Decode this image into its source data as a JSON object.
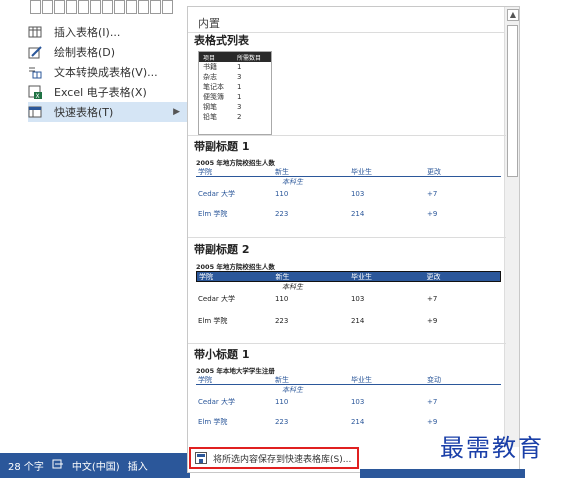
{
  "menu": {
    "items": [
      {
        "label": "插入表格(I)...",
        "icon": "table-grid-icon"
      },
      {
        "label": "绘制表格(D)",
        "icon": "pencil-table-icon"
      },
      {
        "label": "文本转换成表格(V)...",
        "icon": "text-to-table-icon"
      },
      {
        "label": "Excel 电子表格(X)",
        "icon": "excel-icon"
      },
      {
        "label": "快速表格(T)",
        "icon": "quick-table-icon",
        "active": true,
        "arrow": "▶"
      }
    ]
  },
  "status": {
    "word_count": "28 个字",
    "language": "中文(中国)",
    "mode": "插入"
  },
  "gallery": {
    "header": "内置",
    "sections": [
      {
        "title": "表格式列表"
      },
      {
        "title": "带副标题 1"
      },
      {
        "title": "带副标题 2"
      },
      {
        "title": "带小标题 1"
      }
    ],
    "tabular_list": {
      "headers": [
        "项目",
        "所需数目"
      ],
      "rows": [
        [
          "书籍",
          "1"
        ],
        [
          "杂志",
          "3"
        ],
        [
          "笔记本",
          "1"
        ],
        [
          "便笺簿",
          "1"
        ],
        [
          "钢笔",
          "3"
        ],
        [
          "铅笔",
          "2"
        ]
      ]
    },
    "subtitle1": {
      "caption": "2005 年地方院校招生人数",
      "headers": [
        "学院",
        "新生",
        "毕业生",
        "更改"
      ],
      "subheader": "本科生",
      "rows": [
        [
          "Cedar 大学",
          "110",
          "103",
          "+7"
        ],
        [
          "Elm 学院",
          "223",
          "214",
          "+9"
        ]
      ]
    },
    "subtitle2": {
      "caption": "2005 年地方院校招生人数",
      "headers": [
        "学院",
        "新生",
        "毕业生",
        "更改"
      ],
      "subheader": "本科生",
      "rows": [
        [
          "Cedar 大学",
          "110",
          "103",
          "+7"
        ],
        [
          "Elm 学院",
          "223",
          "214",
          "+9"
        ]
      ]
    },
    "tabsub1": {
      "caption": "2005 年本地大学学生注册",
      "headers": [
        "学院",
        "新生",
        "毕业生",
        "变动"
      ],
      "subheader": "本科生",
      "rows": [
        [
          "Cedar 大学",
          "110",
          "103",
          "+7"
        ],
        [
          "Elm 学院",
          "223",
          "214",
          "+9"
        ]
      ]
    },
    "save_label": "将所选内容保存到快速表格库(S)..."
  },
  "watermark": "最需教育",
  "colors": {
    "accent": "#2b579a",
    "highlight": "#d5e5f5",
    "save_border": "#e02020"
  }
}
